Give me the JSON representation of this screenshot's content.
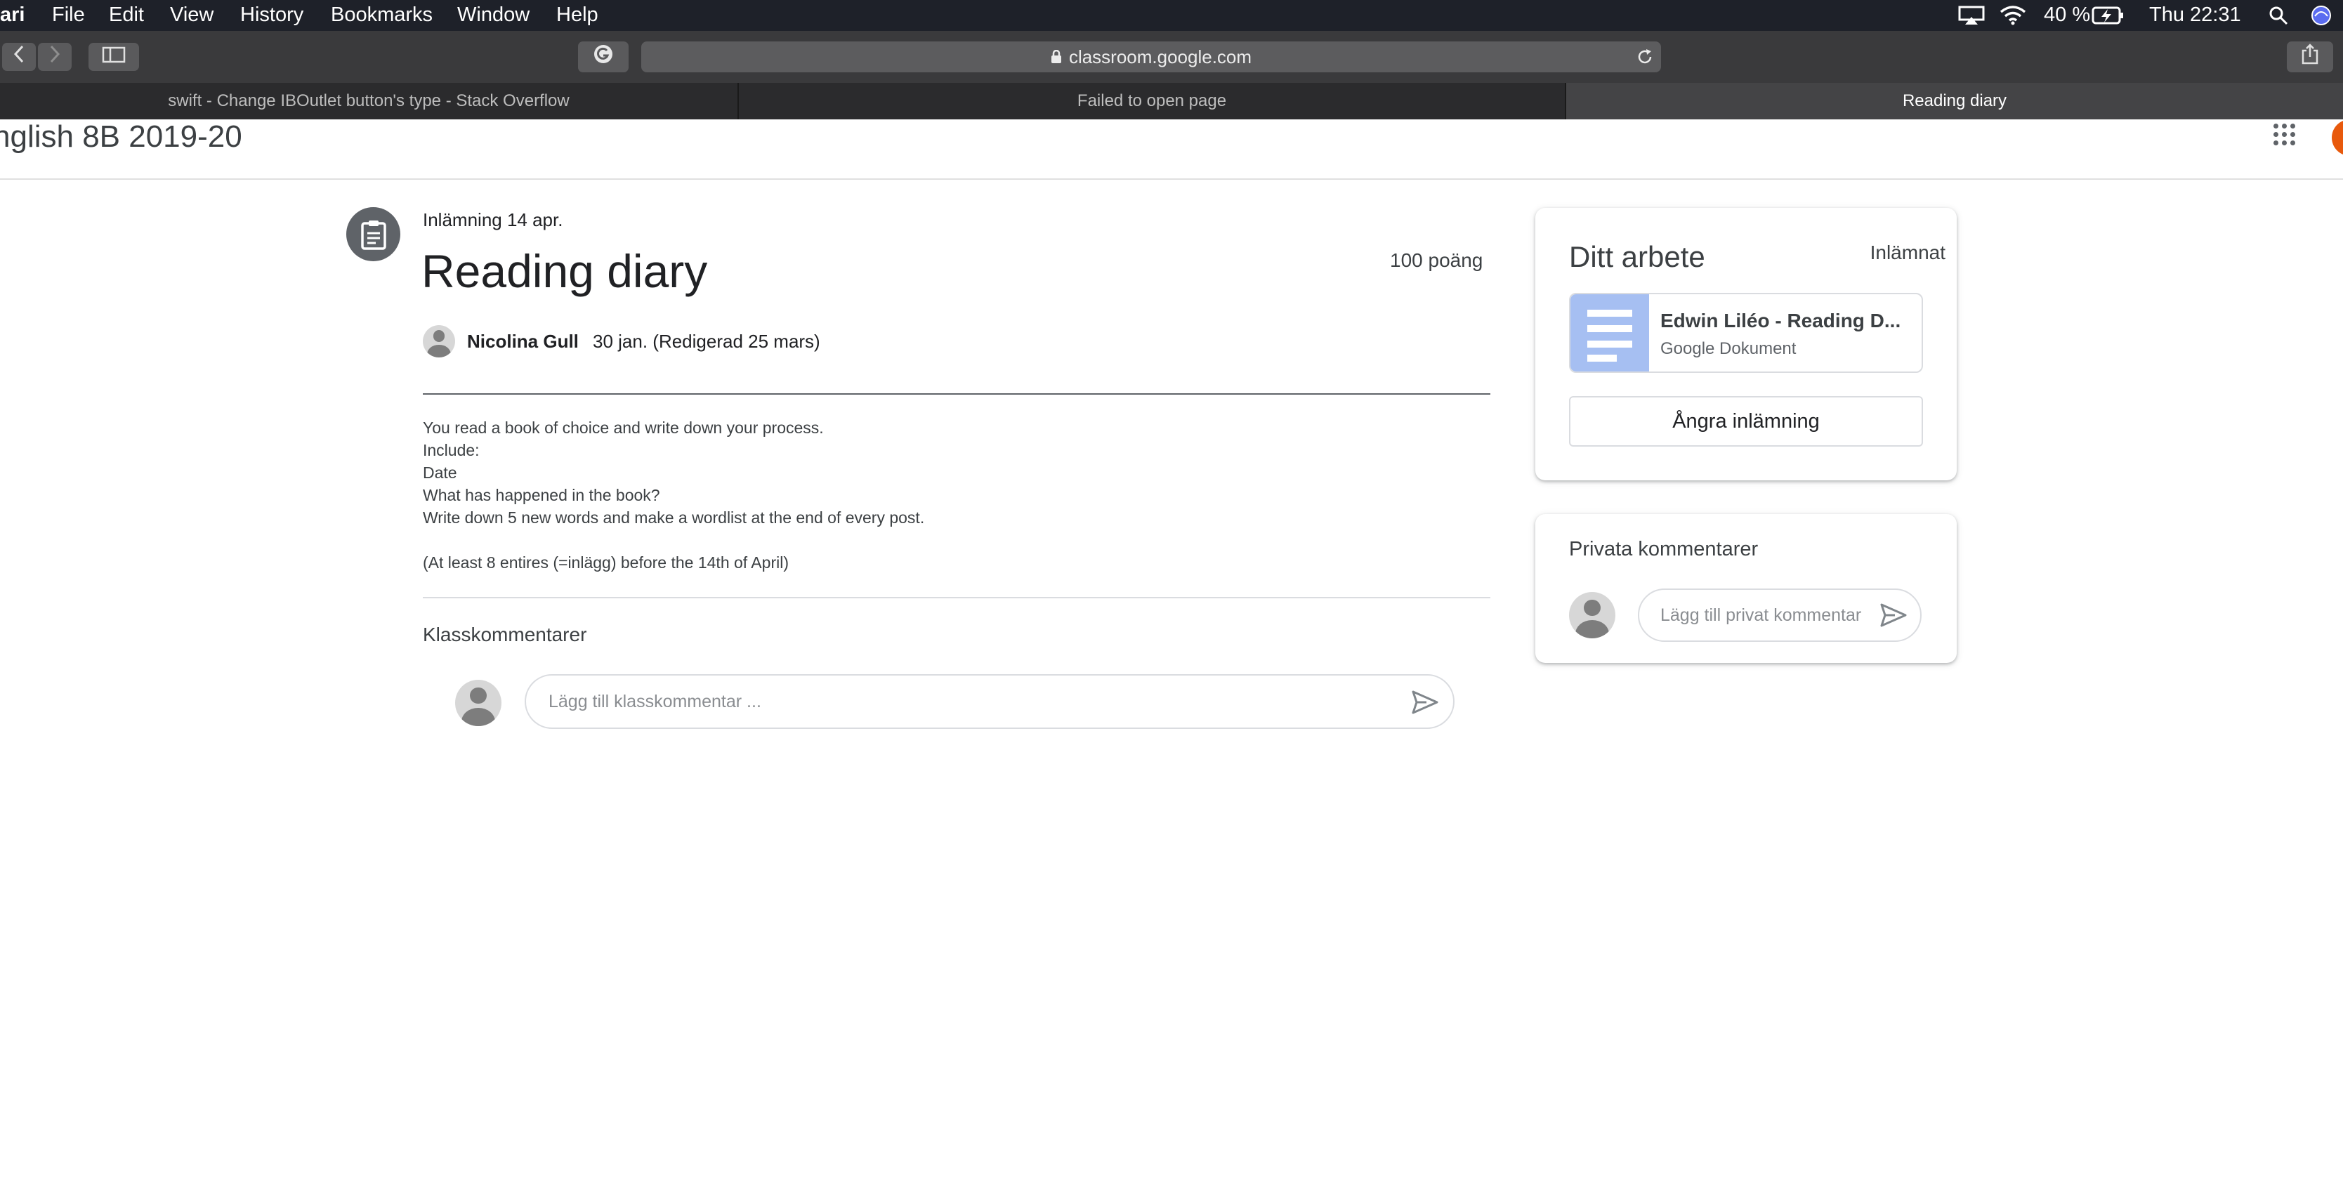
{
  "menubar": {
    "app": "ari",
    "items": [
      "File",
      "Edit",
      "View",
      "History",
      "Bookmarks",
      "Window",
      "Help"
    ],
    "battery": "40 %",
    "clock": "Thu 22:31"
  },
  "browser": {
    "url": "classroom.google.com",
    "tabs": [
      {
        "title": "swift - Change IBOutlet button's type - Stack Overflow",
        "active": false
      },
      {
        "title": "Failed to open page",
        "active": false
      },
      {
        "title": "Reading diary",
        "active": true
      }
    ]
  },
  "classroom": {
    "class_name": "nglish 8B 2019-20"
  },
  "assignment": {
    "due": "Inlämning 14 apr.",
    "title": "Reading diary",
    "points": "100 poäng",
    "author": "Nicolina Gull",
    "date": "30 jan. (Redigerad 25 mars)",
    "description": [
      "You read a book of choice and write down your process.",
      "Include:",
      "Date",
      "What has happened in the book?",
      "Write down 5 new words and make a wordlist at the end of every post.",
      "",
      "(At least 8 entires (=inlägg) before the 14th of April)"
    ]
  },
  "class_comments": {
    "heading": "Klasskommentarer",
    "placeholder": "Lägg till klasskommentar ..."
  },
  "your_work": {
    "heading": "Ditt arbete",
    "status": "Inlämnat",
    "attachment_title": "Edwin Liléo - Reading D...",
    "attachment_type": "Google Dokument",
    "unsubmit_label": "Ångra inlämning"
  },
  "private_comments": {
    "heading": "Privata kommentarer",
    "placeholder": "Lägg till privat kommentar ..."
  },
  "colors": {
    "accent_doc": "#a6bff2",
    "divider_dark": "#5f6368",
    "avatar_orange": "#e8590c"
  }
}
